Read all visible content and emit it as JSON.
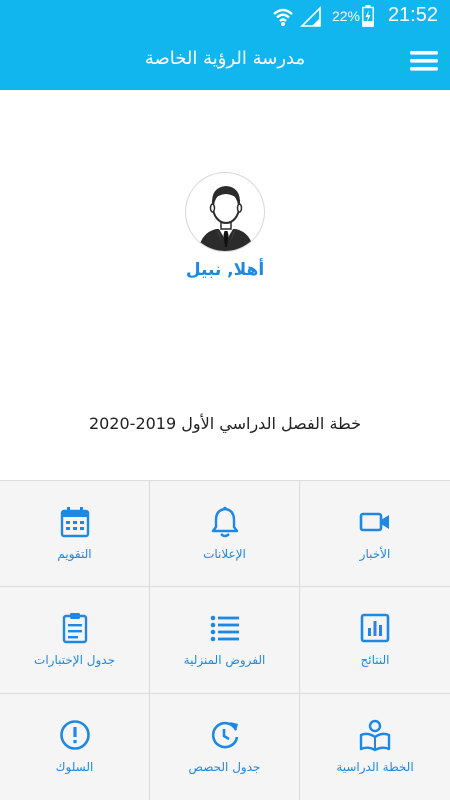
{
  "status_bar": {
    "time": "21:52",
    "battery_percent": "22%",
    "icons": [
      "wifi-icon",
      "signal-icon",
      "battery-charging-icon"
    ]
  },
  "app_bar": {
    "title": "مدرسة الرؤية الخاصة",
    "menu_icon": "hamburger-menu-icon",
    "color": "#12b6ef"
  },
  "profile": {
    "greeting": "أهلا, نبيل",
    "avatar_icon": "user-avatar-icon"
  },
  "plan": {
    "title": "خطة الفصل الدراسي الأول 2019-2020"
  },
  "menu_tiles": [
    {
      "label": "التقويم",
      "icon": "calendar-icon"
    },
    {
      "label": "الإعلانات",
      "icon": "bell-icon"
    },
    {
      "label": "الأخبار",
      "icon": "video-camera-icon"
    },
    {
      "label": "جدول الإختبارات",
      "icon": "clipboard-list-icon"
    },
    {
      "label": "الفروض المنزلية",
      "icon": "list-icon"
    },
    {
      "label": "النتائج",
      "icon": "bar-chart-icon"
    },
    {
      "label": "السلوك",
      "icon": "alert-circle-icon"
    },
    {
      "label": "جدول الحصص",
      "icon": "refresh-clock-icon"
    },
    {
      "label": "الخطة الدراسية",
      "icon": "reader-book-icon"
    }
  ],
  "accent_color": "#1e88e5"
}
